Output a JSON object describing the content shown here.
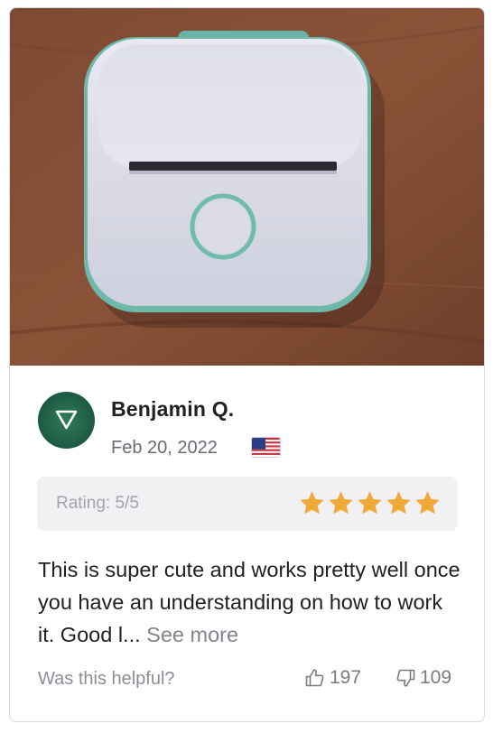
{
  "reviewer": {
    "name": "Benjamin Q.",
    "date": "Feb 20, 2022",
    "flag_icon": "us-flag-icon",
    "avatar_icon": "triangle-down-icon",
    "avatar_color": "#25654b"
  },
  "rating": {
    "label": "Rating: 5/5",
    "stars": 5,
    "star_color": "#f2a83b"
  },
  "review": {
    "text": "This is super cute and works pretty well once you have an understanding on how to work it. Good l...",
    "see_more_label": "See more"
  },
  "footer": {
    "helpful_label": "Was this helpful?",
    "thumbs_up_count": "197",
    "thumbs_down_count": "109"
  }
}
